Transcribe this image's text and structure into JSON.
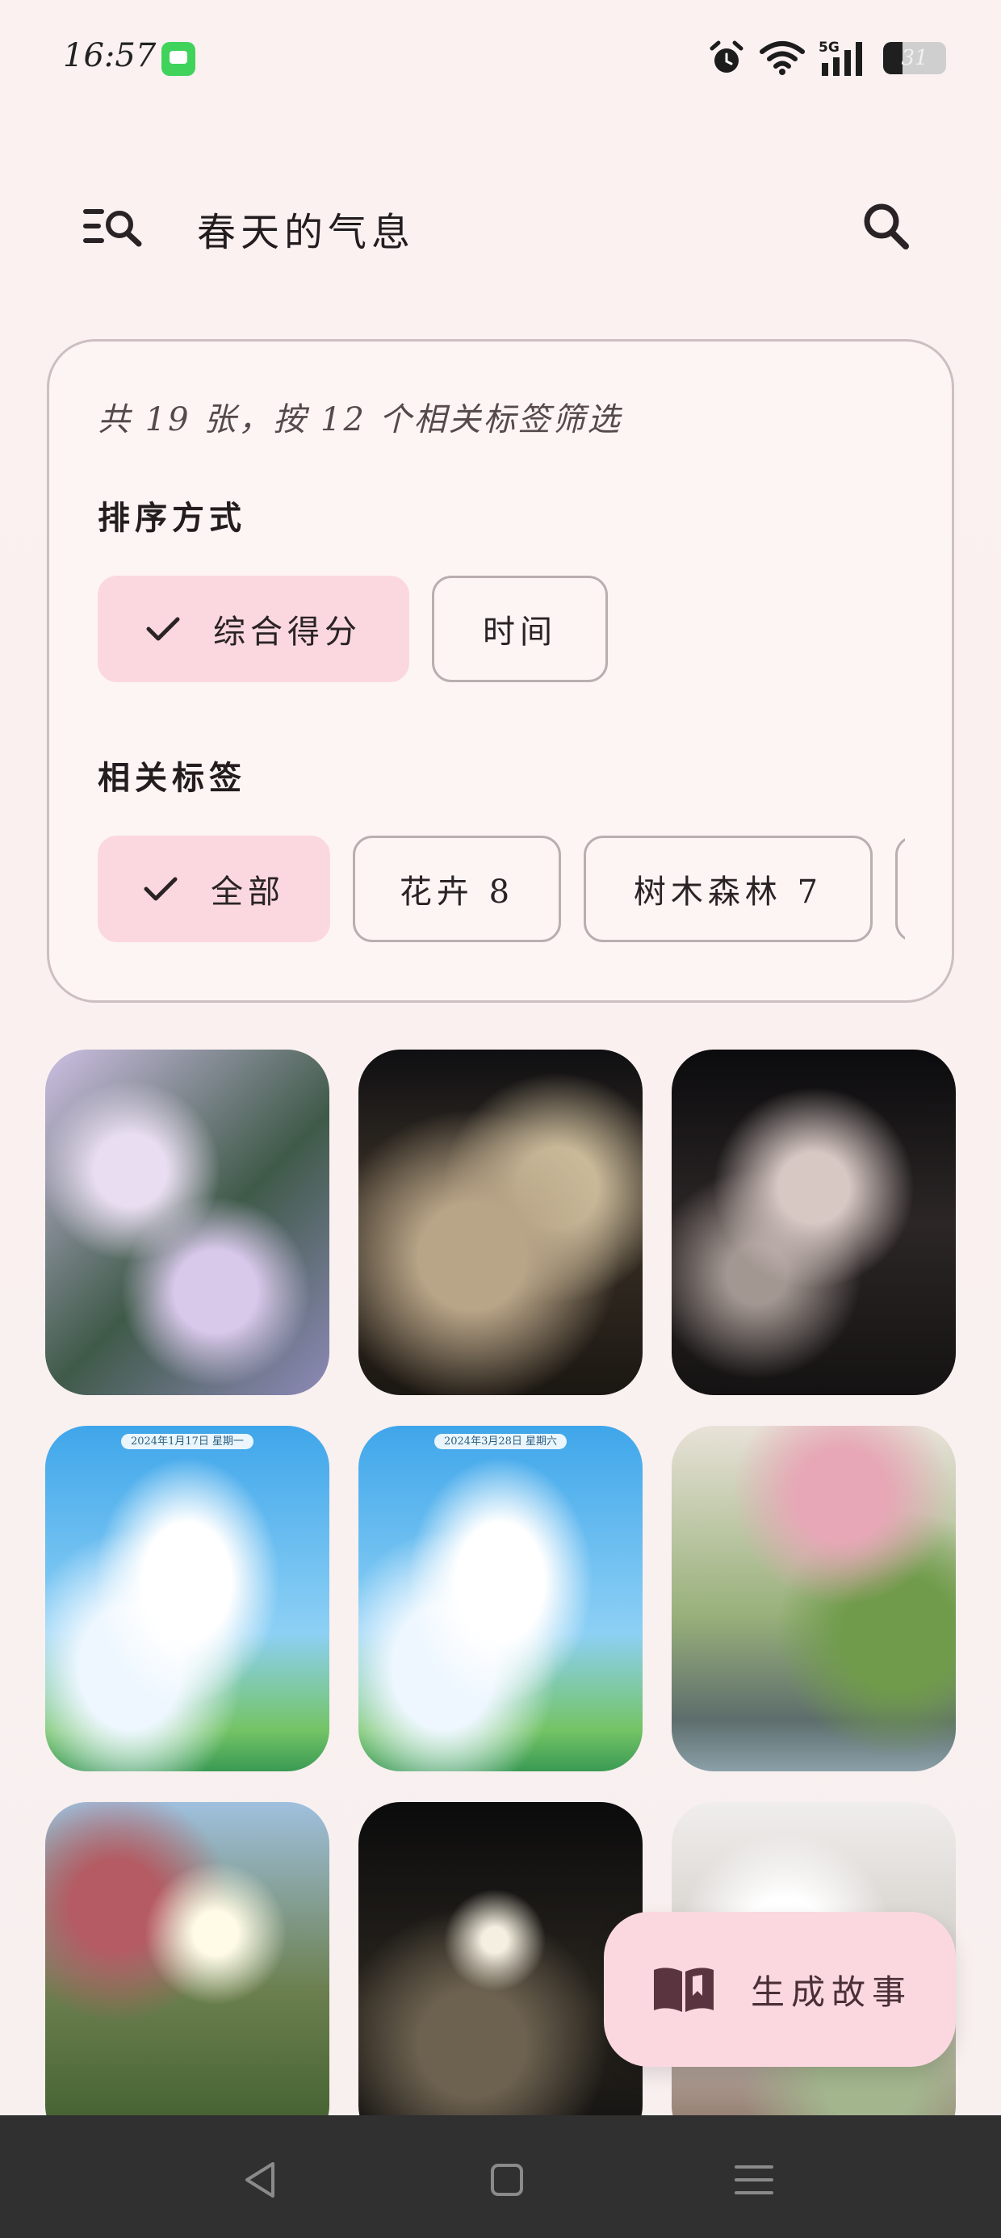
{
  "status_bar": {
    "time": "16:57",
    "battery_text": "31",
    "battery_level": 0.31,
    "icons": [
      "message-app-icon",
      "alarm-icon",
      "wifi-icon",
      "signal-5g-icon",
      "battery-icon"
    ],
    "network_label": "5G"
  },
  "top_bar": {
    "title": "春天的气息",
    "menu_icon": "list-search-icon",
    "search_icon": "search-icon"
  },
  "filter_card": {
    "summary": "共 19 张，按 12 个相关标签筛选",
    "sort_label": "排序方式",
    "sort_options": [
      {
        "label": "综合得分",
        "selected": true
      },
      {
        "label": "时间",
        "selected": false
      }
    ],
    "tags_label": "相关标签",
    "tag_options": [
      {
        "label": "全部",
        "selected": true
      },
      {
        "label": "花卉 8",
        "selected": false
      },
      {
        "label": "树木森林 7",
        "selected": false
      }
    ]
  },
  "photos": {
    "p4_caption": "2024年1月17日 星期一",
    "p5_caption": "2024年3月28日 星期六"
  },
  "fab": {
    "label": "生成故事",
    "icon": "open-book-icon"
  },
  "nav_bar": {
    "icons": [
      "back-icon",
      "home-icon",
      "recents-icon"
    ]
  },
  "colors": {
    "background": "#fbf3f3",
    "chip_selected": "#fbd8df",
    "fab": "#fbd8df",
    "nav_bar": "#303031"
  }
}
